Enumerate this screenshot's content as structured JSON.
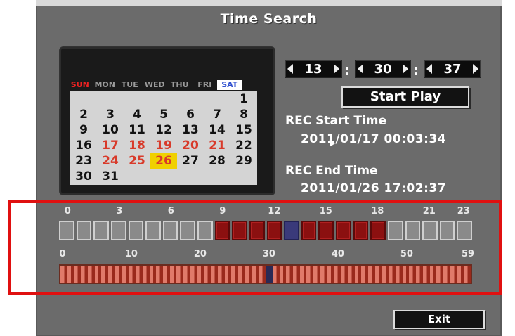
{
  "title": "Time Search",
  "date": {
    "year": "2011",
    "month": "1",
    "day": "26"
  },
  "time": {
    "hour": "13",
    "minute": "30",
    "second": "37"
  },
  "weekdays": [
    "SUN",
    "MON",
    "TUE",
    "WED",
    "THU",
    "FRI",
    "SAT"
  ],
  "calendar": [
    [
      "",
      "",
      "",
      "",
      "",
      "",
      "1"
    ],
    [
      "2",
      "3",
      "4",
      "5",
      "6",
      "7",
      "8"
    ],
    [
      "9",
      "10",
      "11",
      "12",
      "13",
      "14",
      "15"
    ],
    [
      "16",
      "17",
      "18",
      "19",
      "20",
      "21",
      "22"
    ],
    [
      "23",
      "24",
      "25",
      "26",
      "27",
      "28",
      "29"
    ],
    [
      "30",
      "31",
      "",
      "",
      "",
      "",
      ""
    ]
  ],
  "recorded_days": [
    "17",
    "18",
    "19",
    "20",
    "21",
    "24",
    "25",
    "26"
  ],
  "selected_day": "26",
  "start_play_label": "Start Play",
  "rec_start": {
    "label": "REC Start Time",
    "value": "2011/01/17 00:03:34"
  },
  "rec_end": {
    "label": "REC End Time",
    "value": "2011/01/26 17:02:37"
  },
  "hour_scale": {
    "ticks": [
      "0",
      "3",
      "6",
      "9",
      "12",
      "15",
      "18",
      "21",
      "23"
    ],
    "recorded_hours": [
      9,
      10,
      11,
      12,
      14,
      15,
      16,
      17,
      18
    ],
    "current_hour": 13
  },
  "minute_scale": {
    "ticks": [
      "0",
      "10",
      "20",
      "30",
      "40",
      "50",
      "59"
    ],
    "current_minute": 30
  },
  "exit_label": "Exit",
  "colors": {
    "recorded": "#8b1010",
    "selected_day": "#f0d000",
    "highlight": "#e01010"
  }
}
